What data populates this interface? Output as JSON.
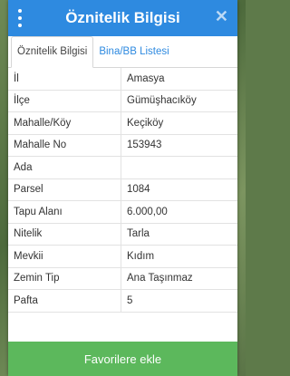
{
  "header": {
    "title": "Öznitelik Bilgisi"
  },
  "tabs": [
    {
      "label": "Öznitelik Bilgisi",
      "active": true
    },
    {
      "label": "Bina/BB Listesi",
      "active": false
    }
  ],
  "rows": [
    {
      "label": "İl",
      "value": "Amasya"
    },
    {
      "label": "İlçe",
      "value": "Gümüşhacıköy"
    },
    {
      "label": "Mahalle/Köy",
      "value": "Keçiköy"
    },
    {
      "label": "Mahalle No",
      "value": "153943"
    },
    {
      "label": "Ada",
      "value": ""
    },
    {
      "label": "Parsel",
      "value": "1084"
    },
    {
      "label": "Tapu Alanı",
      "value": "6.000,00"
    },
    {
      "label": "Nitelik",
      "value": "Tarla"
    },
    {
      "label": "Mevkii",
      "value": "Kıdım"
    },
    {
      "label": "Zemin Tip",
      "value": "Ana Taşınmaz"
    },
    {
      "label": "Pafta",
      "value": "5"
    }
  ],
  "footer": {
    "button_label": "Favorilere ekle"
  },
  "colors": {
    "header": "#2e8ae0",
    "button": "#5cb85c"
  }
}
